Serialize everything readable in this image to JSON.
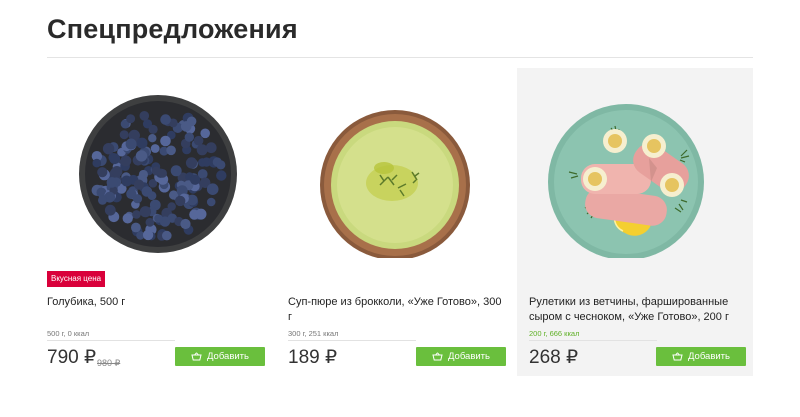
{
  "section": {
    "title": "Спецпредложения"
  },
  "products": [
    {
      "badge": "Вкусная цена",
      "name": "Голубика, 500 г",
      "meta": "500 г, 0 ккал",
      "price": "790 ₽",
      "old_price": "980 ₽",
      "add_label": "Добавить",
      "image_icon": "blueberry-plate-icon"
    },
    {
      "name": "Суп-пюре из брокколи, «Уже Готово», 300 г",
      "meta": "300 г, 251 ккал",
      "price": "189 ₽",
      "add_label": "Добавить",
      "image_icon": "soup-bowl-icon"
    },
    {
      "name": "Рулетики из ветчины, фаршированные сыром с чесноком, «Уже Готово», 200 г",
      "meta": "200 г, 666 ккал",
      "price": "268 ₽",
      "add_label": "Добавить",
      "image_icon": "ham-rolls-plate-icon"
    }
  ],
  "colors": {
    "badge": "#d9003a",
    "button": "#6abf3d",
    "meta_highlight": "#5fb026",
    "card_highlight_bg": "#f3f3f3"
  }
}
